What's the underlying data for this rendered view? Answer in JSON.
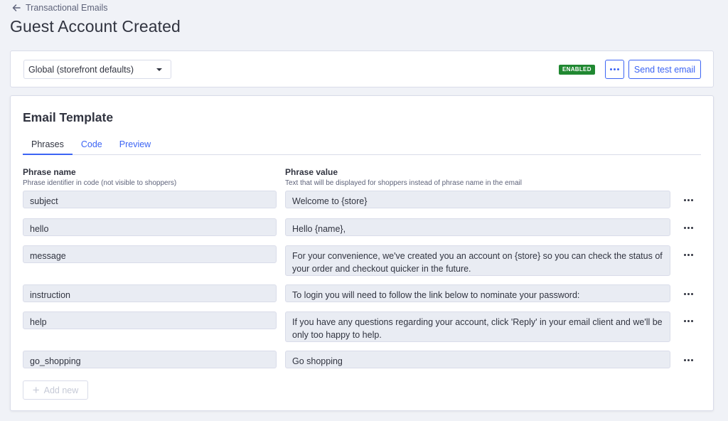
{
  "breadcrumb": {
    "label": "Transactional Emails"
  },
  "page": {
    "title": "Guest Account Created"
  },
  "toolbar": {
    "scope_value": "Global (storefront defaults)",
    "status_badge": "ENABLED",
    "send_test_label": "Send test email"
  },
  "template": {
    "title": "Email Template",
    "tabs": [
      {
        "label": "Phrases",
        "active": true
      },
      {
        "label": "Code",
        "active": false
      },
      {
        "label": "Preview",
        "active": false
      }
    ],
    "columns": {
      "name_header": "Phrase name",
      "name_sub": "Phrase identifier in code (not visible to shoppers)",
      "value_header": "Phrase value",
      "value_sub": "Text that will be displayed for shoppers instead of phrase name in the email"
    },
    "phrases": [
      {
        "name": "subject",
        "value": "Welcome to {store}"
      },
      {
        "name": "hello",
        "value": "Hello {name},"
      },
      {
        "name": "message",
        "value": "For your convenience, we've created you an account on {store} so you can check the status of your order and checkout quicker in the future."
      },
      {
        "name": "instruction",
        "value": "To login you will need to follow the link below to nominate your password:"
      },
      {
        "name": "help",
        "value": "If you have any questions regarding your account, click 'Reply' in your email client and we'll be only too happy to help."
      },
      {
        "name": "go_shopping",
        "value": "Go shopping"
      }
    ],
    "add_new_label": "Add new"
  },
  "colors": {
    "accent": "#3c64f4",
    "enabled_badge": "#208831",
    "field_bg": "#e9ecf3"
  }
}
